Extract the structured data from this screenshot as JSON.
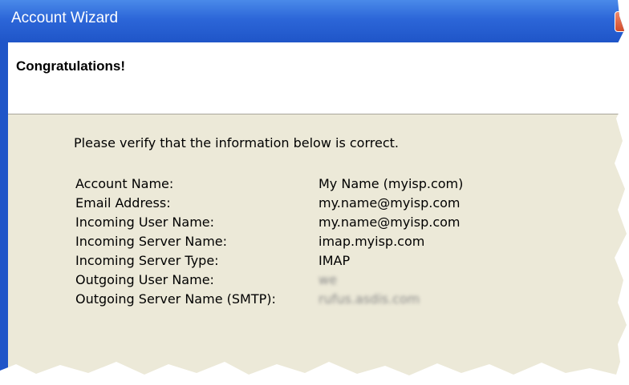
{
  "window": {
    "title": "Account Wizard"
  },
  "header": {
    "title": "Congratulations!"
  },
  "content": {
    "intro": "Please verify that the information below is correct.",
    "rows": [
      {
        "label": "Account Name:",
        "value": "My Name (myisp.com)"
      },
      {
        "label": "Email Address:",
        "value": "my.name@myisp.com"
      },
      {
        "label": "Incoming User Name:",
        "value": "my.name@myisp.com"
      },
      {
        "label": "Incoming Server Name:",
        "value": "imap.myisp.com"
      },
      {
        "label": "Incoming Server Type:",
        "value": "IMAP"
      },
      {
        "label": "Outgoing User Name:",
        "value": "we"
      },
      {
        "label": "Outgoing Server Name (SMTP):",
        "value": "rufus.asdis.com"
      }
    ]
  },
  "colors": {
    "titlebar": "#2c66d8",
    "content_bg": "#ece9d8",
    "header_bg": "#ffffff"
  },
  "icons": {
    "close": "close-icon"
  }
}
